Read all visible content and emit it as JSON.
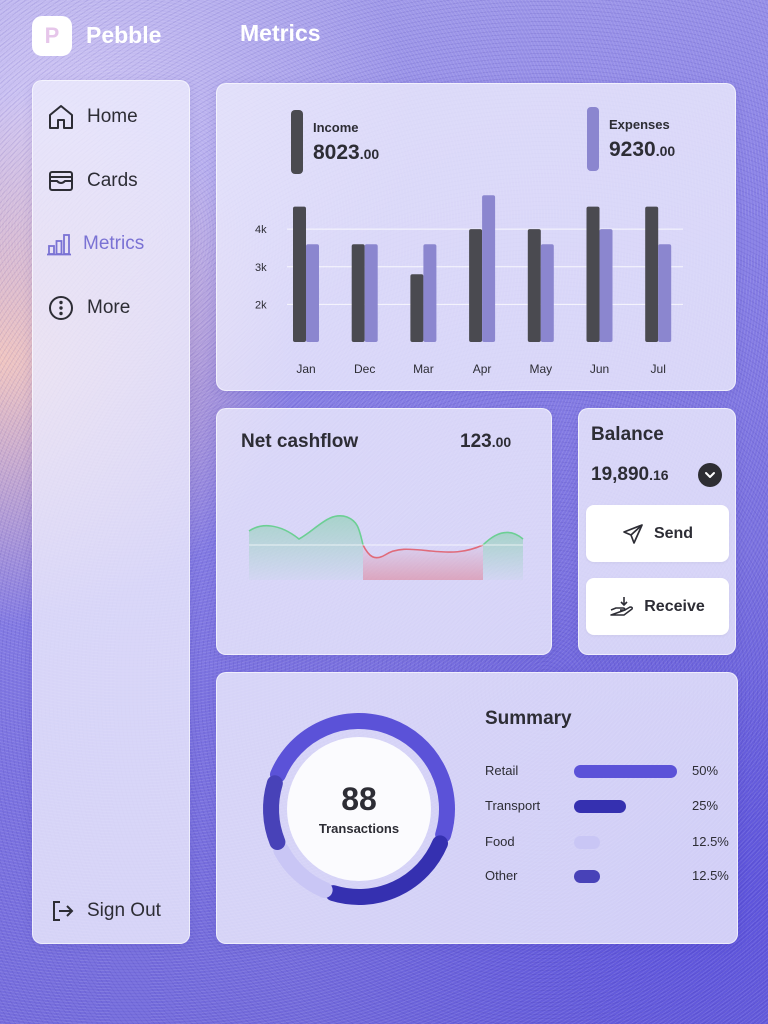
{
  "app": {
    "logo_letter": "P",
    "brand": "Pebble",
    "page_title": "Metrics"
  },
  "sidebar": {
    "items": [
      {
        "label": "Home",
        "icon": "home-icon"
      },
      {
        "label": "Cards",
        "icon": "card-icon"
      },
      {
        "label": "Metrics",
        "icon": "bar-chart-icon",
        "active": true
      },
      {
        "label": "More",
        "icon": "more-icon"
      }
    ],
    "sign_out": "Sign Out"
  },
  "income_expenses": {
    "income": {
      "label": "Income",
      "value_main": "8023",
      "value_cents": ".00",
      "color": "#4a4a50"
    },
    "expenses": {
      "label": "Expenses",
      "value_main": "9230",
      "value_cents": ".00",
      "color": "#8b86cf"
    }
  },
  "chart_data": {
    "type": "bar",
    "categories": [
      "Jan",
      "Dec",
      "Mar",
      "Apr",
      "May",
      "Jun",
      "Jul"
    ],
    "series": [
      {
        "name": "Income",
        "values": [
          4.6,
          3.6,
          2.8,
          4.0,
          4.0,
          4.6,
          4.6
        ],
        "color": "#4a4a50"
      },
      {
        "name": "Expenses",
        "values": [
          3.6,
          3.6,
          3.6,
          4.9,
          3.6,
          4.0,
          3.6
        ],
        "color": "#8b86cf"
      }
    ],
    "ytick_labels": [
      "2k",
      "3k",
      "4k"
    ],
    "ylim": [
      1.0,
      5.2
    ],
    "grid": true
  },
  "cashflow": {
    "title": "Net cashflow",
    "value_main": "123",
    "value_cents": ".00",
    "positive_color": "#6ccf94",
    "negative_color": "#e06b7a"
  },
  "balance": {
    "title": "Balance",
    "value_main": "19,890",
    "value_cents": ".16",
    "send_label": "Send",
    "receive_label": "Receive"
  },
  "summary": {
    "title": "Summary",
    "total": "88",
    "total_label": "Transactions",
    "items": [
      {
        "name": "Retail",
        "percent": "50%",
        "share": 0.5,
        "color": "#5b52d8"
      },
      {
        "name": "Transport",
        "percent": "25%",
        "share": 0.25,
        "color": "#3530b0"
      },
      {
        "name": "Food",
        "percent": "12.5%",
        "share": 0.125,
        "color": "#c9c6f5"
      },
      {
        "name": "Other",
        "percent": "12.5%",
        "share": 0.125,
        "color": "#4842b8"
      }
    ]
  }
}
